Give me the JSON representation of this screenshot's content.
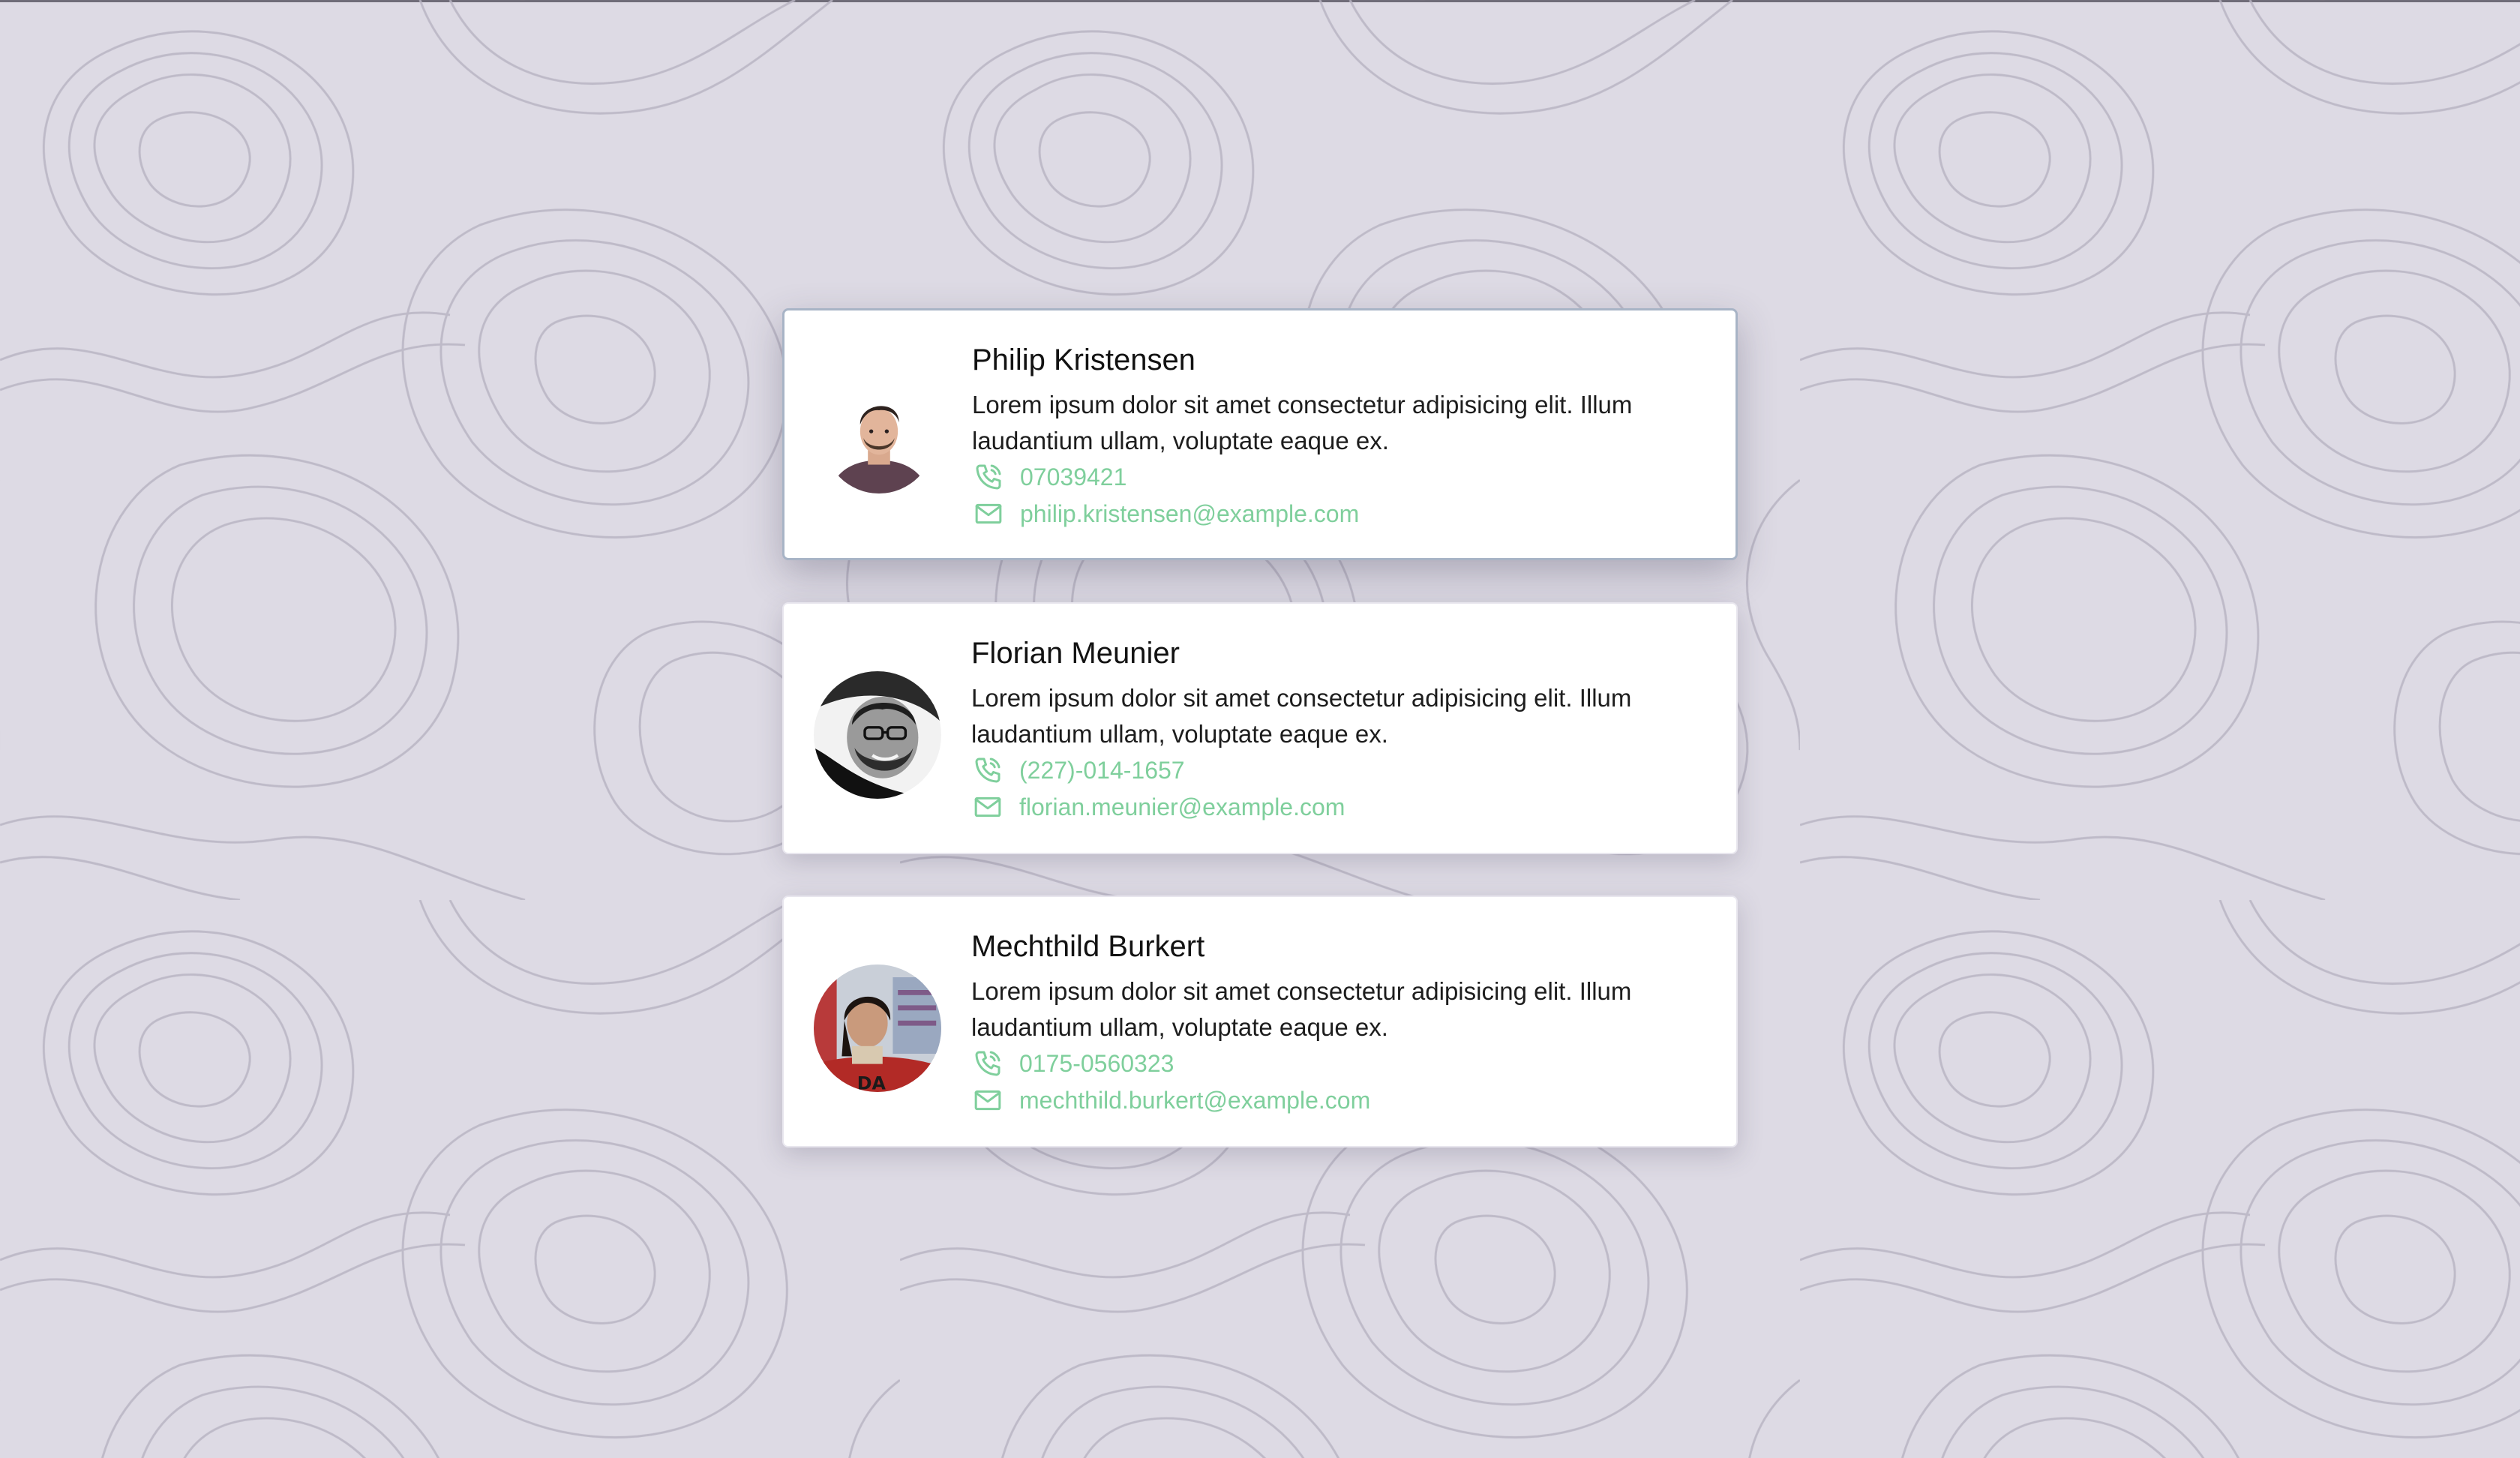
{
  "accent_color": "#7fcf9c",
  "background_color": "#dddae4",
  "contacts": [
    {
      "name": "Philip Kristensen",
      "description": "Lorem ipsum dolor sit amet consectetur adipisicing elit. Illum laudantium ullam, voluptate eaque ex.",
      "phone": "07039421",
      "email": "philip.kristensen@example.com",
      "phone_icon": "phone-icon",
      "email_icon": "mail-icon",
      "selected": true
    },
    {
      "name": "Florian Meunier",
      "description": "Lorem ipsum dolor sit amet consectetur adipisicing elit. Illum laudantium ullam, voluptate eaque ex.",
      "phone": "(227)-014-1657",
      "email": "florian.meunier@example.com",
      "phone_icon": "phone-icon",
      "email_icon": "mail-icon",
      "selected": false
    },
    {
      "name": "Mechthild Burkert",
      "description": "Lorem ipsum dolor sit amet consectetur adipisicing elit. Illum laudantium ullam, voluptate eaque ex.",
      "phone": "0175-0560323",
      "email": "mechthild.burkert@example.com",
      "phone_icon": "phone-icon",
      "email_icon": "mail-icon",
      "selected": false
    }
  ]
}
